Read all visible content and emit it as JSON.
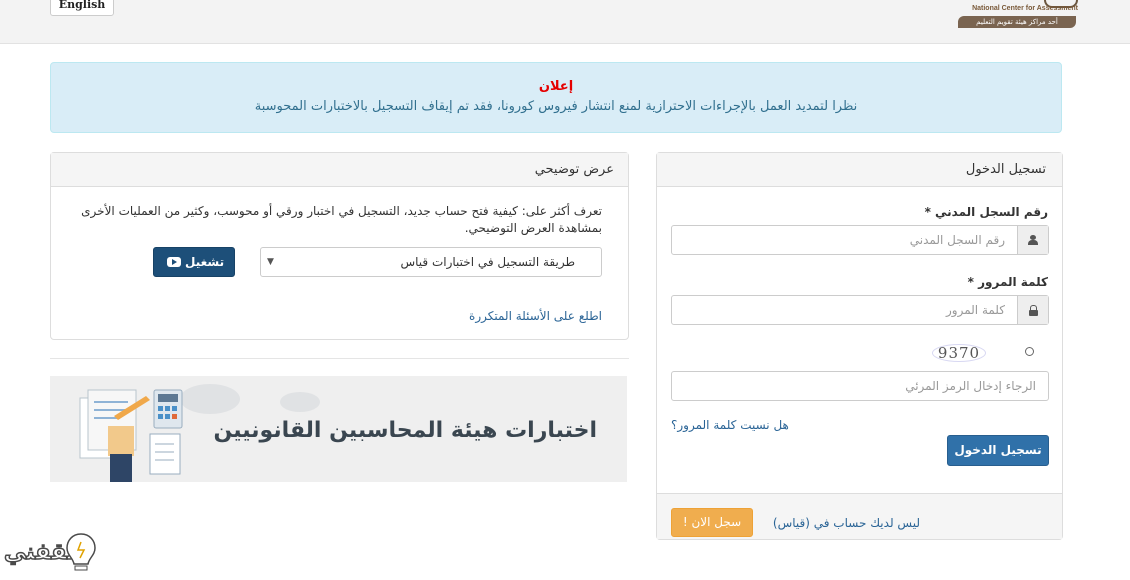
{
  "header": {
    "lang_button": "English",
    "logo_en": "National Center for Assessment",
    "logo_ar": "أحد مراكز هيئة تقويم التعليم"
  },
  "alert": {
    "title": "إعلان",
    "text": "نظرا لتمديد العمل بالإجراءات الاحترازية لمنع انتشار فيروس كورونا، فقد تم إيقاف التسجيل بالاختبارات المحوسبة"
  },
  "demo": {
    "heading": "عرض توضيحي",
    "description": "تعرف أكثر على: كيفية فتح حساب جديد، التسجيل في اختبار ورقي أو محوسب، وكثير من العمليات الأخرى بمشاهدة العرض التوضيحي.",
    "selected_option": "طريقة التسجيل في اختبارات قياس",
    "play_label": "تشغيل",
    "faq_link": "اطلع على الأسئلة المتكررة"
  },
  "banner": {
    "text": "اختبارات هيئة المحاسبين القانونيين"
  },
  "login": {
    "heading": "تسجيل الدخول",
    "civil_id_label": "رقم السجل المدني *",
    "civil_id_placeholder": "رقم السجل المدني",
    "civil_id_value": "",
    "password_label": "كلمة المرور *",
    "password_placeholder": "كلمة المرور",
    "password_value": "",
    "captcha_code": "9370",
    "captcha_placeholder": "الرجاء إدخال الرمز المرئي",
    "forgot_link": "هل نسيت كلمة المرور؟",
    "submit_label": "تسجيل الدخول",
    "no_account_text": "ليس لديك حساب في (قياس)",
    "signup_label": "سجل الان !"
  },
  "watermark": {
    "text": "ثقفني"
  },
  "colors": {
    "primary": "#3071a9",
    "dark_button": "#1d4f79",
    "warning": "#f0ad4e",
    "alert_bg": "#d9edf7",
    "alert_title": "#e50000",
    "link": "#2a6496"
  }
}
